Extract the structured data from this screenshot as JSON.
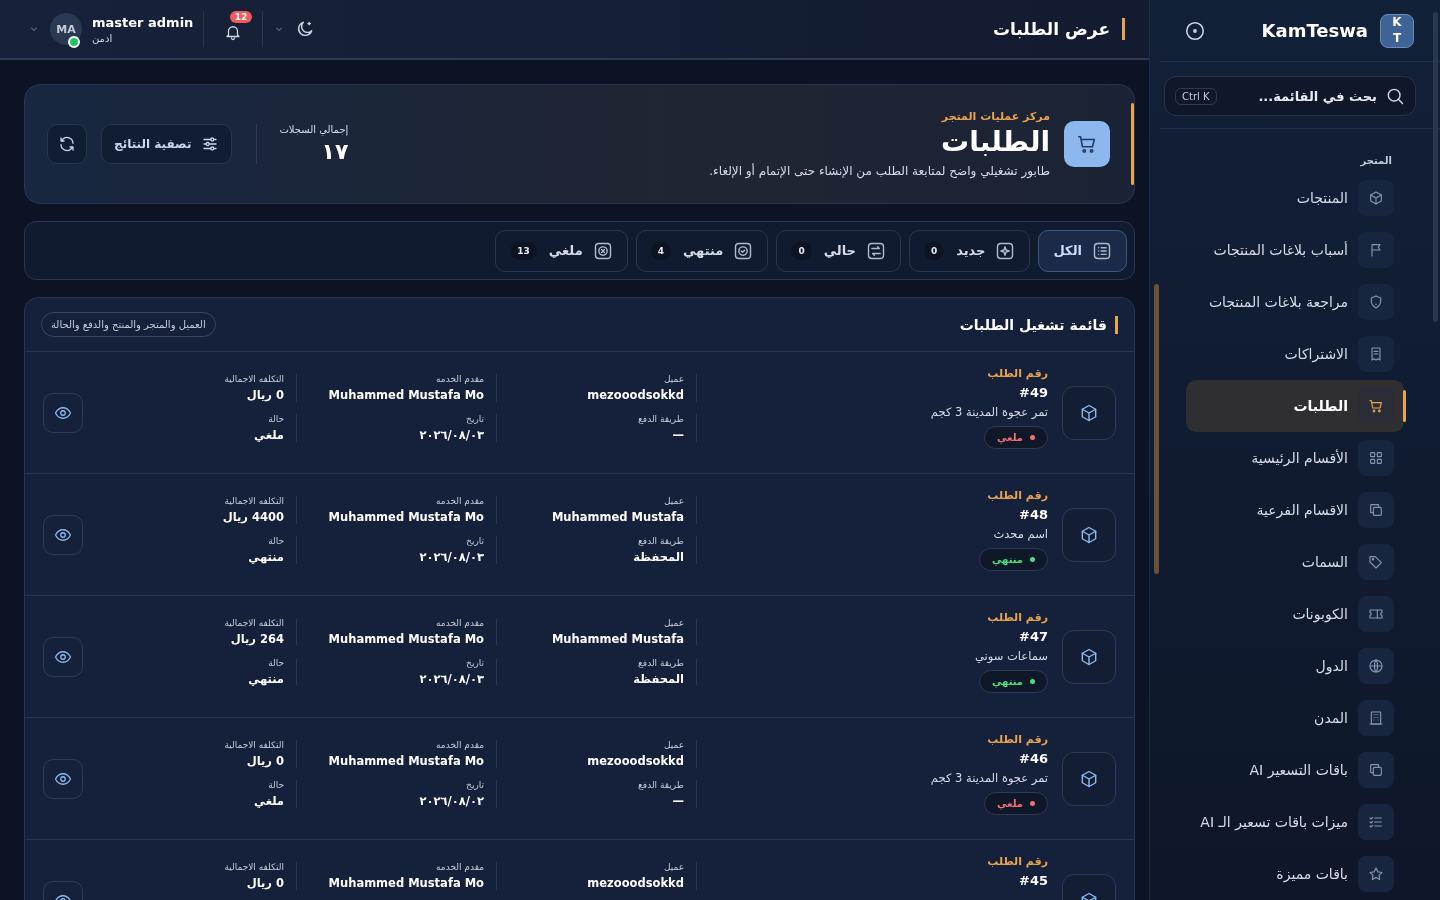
{
  "topbar": {
    "title": "عرض الطلبات",
    "user": {
      "name": "master admin",
      "role": "ادمن",
      "initials": "MA",
      "online": true
    },
    "notifications": "12"
  },
  "sidebar": {
    "brand": "KamTeswa",
    "logo": "KT",
    "search": {
      "placeholder": "بحث في القائمة...",
      "shortcut": "Ctrl K"
    },
    "group": "المتجر",
    "items": [
      {
        "label": "المنتجات",
        "selected": false
      },
      {
        "label": "أسباب بلاغات المنتجات",
        "selected": false
      },
      {
        "label": "مراجعة بلاغات المنتجات",
        "selected": false
      },
      {
        "label": "الاشتراكات",
        "selected": false
      },
      {
        "label": "الطلبات",
        "selected": true
      },
      {
        "label": "الأقسام الرئيسية",
        "selected": false
      },
      {
        "label": "الاقسام الفرعية",
        "selected": false
      },
      {
        "label": "السمات",
        "selected": false
      },
      {
        "label": "الكوبونات",
        "selected": false
      },
      {
        "label": "الدول",
        "selected": false
      },
      {
        "label": "المدن",
        "selected": false
      },
      {
        "label": "باقات التسعير AI",
        "selected": false
      },
      {
        "label": "ميزات باقات تسعير الـ AI",
        "selected": false
      },
      {
        "label": "باقات مميزة",
        "selected": false
      }
    ]
  },
  "hero": {
    "eyebrow": "مركز عمليات المتجر",
    "title": "الطلبات",
    "description": "طابور تشغيلي واضح لمتابعة الطلب من الإنشاء حتى الإتمام أو الإلغاء.",
    "total_label": "إجمالي السجلات",
    "total": "١٧",
    "filter_button": "تصفية النتائج"
  },
  "tabs": [
    {
      "label": "الكل",
      "selected": true
    },
    {
      "label": "جديد",
      "count": "0",
      "selected": false
    },
    {
      "label": "حالي",
      "count": "0",
      "selected": false
    },
    {
      "label": "منتهي",
      "count": "4",
      "selected": false
    },
    {
      "label": "ملغي",
      "count": "13",
      "selected": false
    }
  ],
  "list": {
    "title": "قائمة تشغيل الطلبات",
    "chip": "العميل والمتجر والمنتج والدفع والحالة",
    "orders": [
      {
        "number_label": "رقم الطلب",
        "number": "#49",
        "product": "تمر عجوة المدينة 3 كجم",
        "status": {
          "label": "ملغي",
          "color": "#f87171"
        },
        "fields": [
          {
            "label": "عميل",
            "value": "mezooodsokkd"
          },
          {
            "label": "مقدم الخدمه",
            "value": "Muhammed Mustafa Mo"
          },
          {
            "label": "التكلفه الاجمالية",
            "value": "0 ريال"
          },
          {
            "label": "طريقة الدفع",
            "value": "—"
          },
          {
            "label": "تاريخ",
            "value": "٢٠٢٦/٠٨/٠٣"
          },
          {
            "label": "حالة",
            "value": "ملغي"
          }
        ]
      },
      {
        "number_label": "رقم الطلب",
        "number": "#48",
        "product": "اسم محدث",
        "status": {
          "label": "منتهي",
          "color": "#4ade80"
        },
        "fields": [
          {
            "label": "عميل",
            "value": "Muhammed Mustafa"
          },
          {
            "label": "مقدم الخدمه",
            "value": "Muhammed Mustafa Mo"
          },
          {
            "label": "التكلفه الاجمالية",
            "value": "4400 ريال"
          },
          {
            "label": "طريقة الدفع",
            "value": "المحفظة"
          },
          {
            "label": "تاريخ",
            "value": "٢٠٢٦/٠٨/٠٣"
          },
          {
            "label": "حالة",
            "value": "منتهي"
          }
        ]
      },
      {
        "number_label": "رقم الطلب",
        "number": "#47",
        "product": "سماعات سوني",
        "status": {
          "label": "منتهي",
          "color": "#4ade80"
        },
        "fields": [
          {
            "label": "عميل",
            "value": "Muhammed Mustafa"
          },
          {
            "label": "مقدم الخدمه",
            "value": "Muhammed Mustafa Mo"
          },
          {
            "label": "التكلفه الاجمالية",
            "value": "264 ريال"
          },
          {
            "label": "طريقة الدفع",
            "value": "المحفظة"
          },
          {
            "label": "تاريخ",
            "value": "٢٠٢٦/٠٨/٠٣"
          },
          {
            "label": "حالة",
            "value": "منتهي"
          }
        ]
      },
      {
        "number_label": "رقم الطلب",
        "number": "#46",
        "product": "تمر عجوة المدينة 3 كجم",
        "status": {
          "label": "ملغي",
          "color": "#f87171"
        },
        "fields": [
          {
            "label": "عميل",
            "value": "mezooodsokkd"
          },
          {
            "label": "مقدم الخدمه",
            "value": "Muhammed Mustafa Mo"
          },
          {
            "label": "التكلفه الاجمالية",
            "value": "0 ريال"
          },
          {
            "label": "طريقة الدفع",
            "value": "—"
          },
          {
            "label": "تاريخ",
            "value": "٢٠٢٦/٠٨/٠٢"
          },
          {
            "label": "حالة",
            "value": "ملغي"
          }
        ]
      },
      {
        "number_label": "رقم الطلب",
        "number": "#45",
        "fields": [
          {
            "label": "عميل",
            "value": "mezooodsokkd"
          },
          {
            "label": "مقدم الخدمه",
            "value": "Muhammed Mustafa Mo"
          },
          {
            "label": "التكلفه الاجمالية",
            "value": "0 ريال"
          }
        ]
      }
    ]
  }
}
